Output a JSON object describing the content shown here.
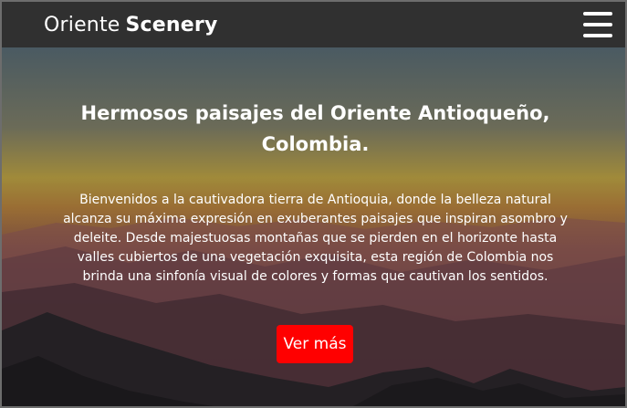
{
  "navbar": {
    "brand_light": "Oriente",
    "brand_bold": "Scenery",
    "menu_icon": "hamburger-menu-icon"
  },
  "hero": {
    "title": "Hermosos paisajes del Oriente Antioqueño, Colombia.",
    "text": "Bienvenidos a la cautivadora tierra de Antioquia, donde la belleza natural alcanza su máxima expresión en exuberantes paisajes que inspiran asombro y deleite. Desde majestuosas montañas que se pierden en el horizonte hasta valles cubiertos de una vegetación exquisita, esta región de Colombia nos brinda una sinfonía visual de colores y formas que cautivan los sentidos.",
    "button_label": "Ver más"
  },
  "colors": {
    "navbar_bg": "#303030",
    "button_bg": "#ff0000",
    "text": "#ffffff"
  }
}
